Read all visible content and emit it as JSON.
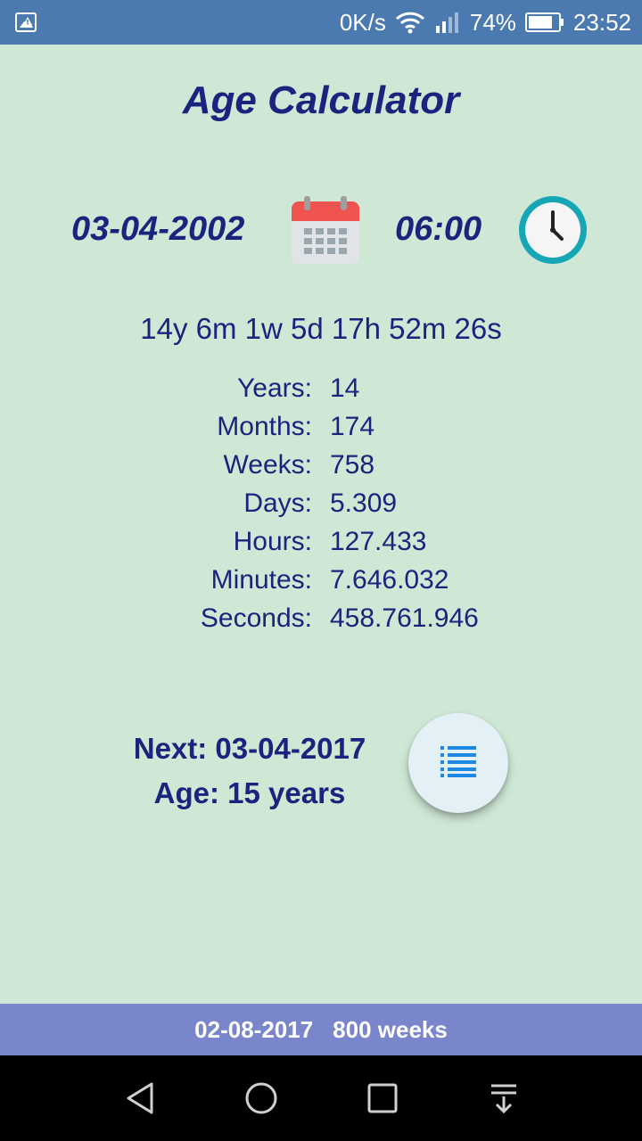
{
  "status_bar": {
    "net_speed": "0K/s",
    "battery": "74%",
    "time": "23:52",
    "icons": [
      "image-warning-icon",
      "wifi-icon",
      "signal-icon",
      "battery-icon"
    ]
  },
  "app": {
    "title": "Age Calculator"
  },
  "birth": {
    "date": "03-04-2002",
    "time": "06:00",
    "icons": [
      "calendar-icon",
      "clock-icon"
    ]
  },
  "summary": "14y 6m 1w 5d 17h 52m 26s",
  "stats": [
    {
      "label": "Years:",
      "value": "14"
    },
    {
      "label": "Months:",
      "value": "174"
    },
    {
      "label": "Weeks:",
      "value": "758"
    },
    {
      "label": "Days:",
      "value": "5.309"
    },
    {
      "label": "Hours:",
      "value": "127.433"
    },
    {
      "label": "Minutes:",
      "value": "7.646.032"
    },
    {
      "label": "Seconds:",
      "value": "458.761.946"
    }
  ],
  "next": {
    "date_line": "Next: 03-04-2017",
    "age_line": "Age: 15 years",
    "fab_icon": "list-icon"
  },
  "footer": {
    "date": "02-08-2017",
    "weeks": "800 weeks"
  },
  "nav_bar": {
    "icons": [
      "back-icon",
      "home-icon",
      "recents-icon",
      "notifications-icon"
    ]
  },
  "colors": {
    "background": "#cfe8d5",
    "status_bar": "#4a7ab0",
    "text": "#1a237e",
    "footer": "#7986cb",
    "accent_teal": "#16a6b6",
    "calendar_red": "#ef5350",
    "fab_icon": "#1e88e5"
  }
}
